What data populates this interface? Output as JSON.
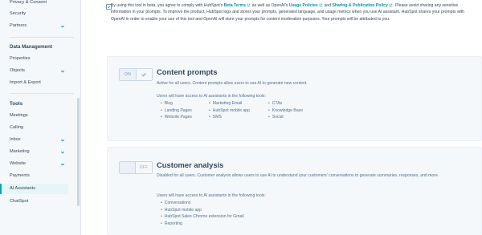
{
  "sidebar": {
    "top_items": [
      {
        "label": "Privacy & Consent",
        "chevron": false
      },
      {
        "label": "Security",
        "chevron": false
      },
      {
        "label": "Partners",
        "chevron": true
      }
    ],
    "data_management": {
      "heading": "Data Management",
      "items": [
        {
          "label": "Properties",
          "chevron": false
        },
        {
          "label": "Objects",
          "chevron": true
        },
        {
          "label": "Import & Export",
          "chevron": false
        }
      ]
    },
    "tools": {
      "heading": "Tools",
      "items": [
        {
          "label": "Meetings",
          "chevron": false
        },
        {
          "label": "Calling",
          "chevron": false
        },
        {
          "label": "Inbox",
          "chevron": true
        },
        {
          "label": "Marketing",
          "chevron": true
        },
        {
          "label": "Website",
          "chevron": true
        },
        {
          "label": "Payments",
          "chevron": false
        },
        {
          "label": "AI Assistants",
          "chevron": false,
          "active": true
        },
        {
          "label": "ChatSpot",
          "chevron": false
        }
      ]
    }
  },
  "terms": {
    "checked": true,
    "part1": "By using this tool in beta, you agree to comply with HubSpot's ",
    "beta_terms": "Beta Terms",
    "part2": " as well as OpenAI's ",
    "usage_policies": "Usage Policies",
    "part3": " and ",
    "sharing_policy": "Sharing & Publication Policy",
    "part4": ". Please avoid sharing any sensitive information in your prompts. To improve the product, HubSpot logs and stores your prompts, generated language, and usage metrics when you use AI assistant. HubSpot shares your prompts with OpenAI in order to enable your use of this tool and OpenAI will store your prompts for content moderation purposes. Your prompts will be attributed to you."
  },
  "content_prompts": {
    "toggle_state": "ON",
    "title": "Content prompts",
    "description": "Active for all users. Content prompts allow users to use AI to generate new content.",
    "tools_intro": "Users will have access to AI assistants in the following tools:",
    "col1": [
      "Blog",
      "Landing Pages",
      "Website Pages"
    ],
    "col2": [
      "Marketing Email",
      "HubSpot mobile app",
      "SMS"
    ],
    "col3": [
      "CTAs",
      "Knowledge Base",
      "Social"
    ]
  },
  "customer_analysis": {
    "toggle_state": "OFF",
    "title": "Customer analysis",
    "description": "Disabled for all users. Customer analysis allows users to use AI to understand your customers' conversations to generate summaries, responses, and more.",
    "tools_intro": "Users will have access to AI assistants in the following tools:",
    "col1": [
      "Conversations",
      "HubSpot mobile app",
      "HubSpot Sales Chrome extension for Gmail",
      "Reporting"
    ]
  }
}
